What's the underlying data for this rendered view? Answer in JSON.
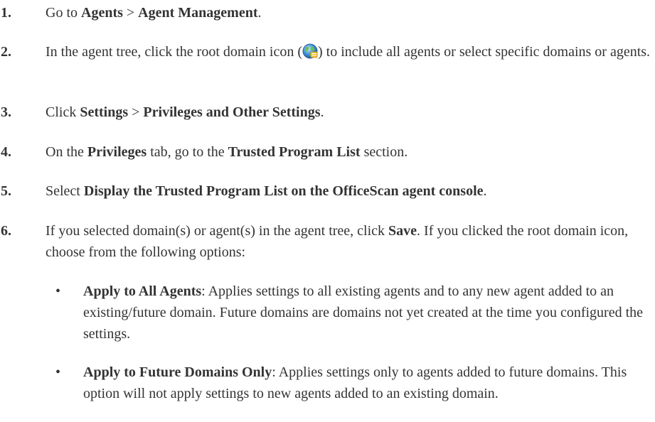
{
  "steps": [
    {
      "number": "1.",
      "parts": [
        "Go to ",
        "Agents",
        " > ",
        "Agent Management",
        "."
      ]
    },
    {
      "number": "2.",
      "parts": [
        "In the agent tree, click the root domain icon (",
        ") to include all agents or select specific domains or agents."
      ],
      "icon": "root-domain-globe-icon"
    },
    {
      "number": "3.",
      "parts": [
        "Click ",
        "Settings",
        " > ",
        "Privileges and Other Settings",
        "."
      ]
    },
    {
      "number": "4.",
      "parts": [
        "On the ",
        "Privileges",
        " tab, go to the ",
        "Trusted Program List",
        " section."
      ]
    },
    {
      "number": "5.",
      "parts": [
        "Select ",
        "Display the Trusted Program List on the OfficeScan agent console",
        "."
      ]
    },
    {
      "number": "6.",
      "parts": [
        "If you selected domain(s) or agent(s) in the agent tree, click ",
        "Save",
        ". If you clicked the root domain icon, choose from the following options:"
      ]
    }
  ],
  "options": [
    {
      "bullet": "•",
      "title": "Apply to All Agents",
      "desc": ": Applies settings to all existing agents and to any new agent added to an existing/future domain. Future domains are domains not yet created at the time you configured the settings."
    },
    {
      "bullet": "•",
      "title": "Apply to Future Domains Only",
      "desc": ": Applies settings only to agents added to future domains. This option will not apply settings to new agents added to an existing domain."
    }
  ]
}
